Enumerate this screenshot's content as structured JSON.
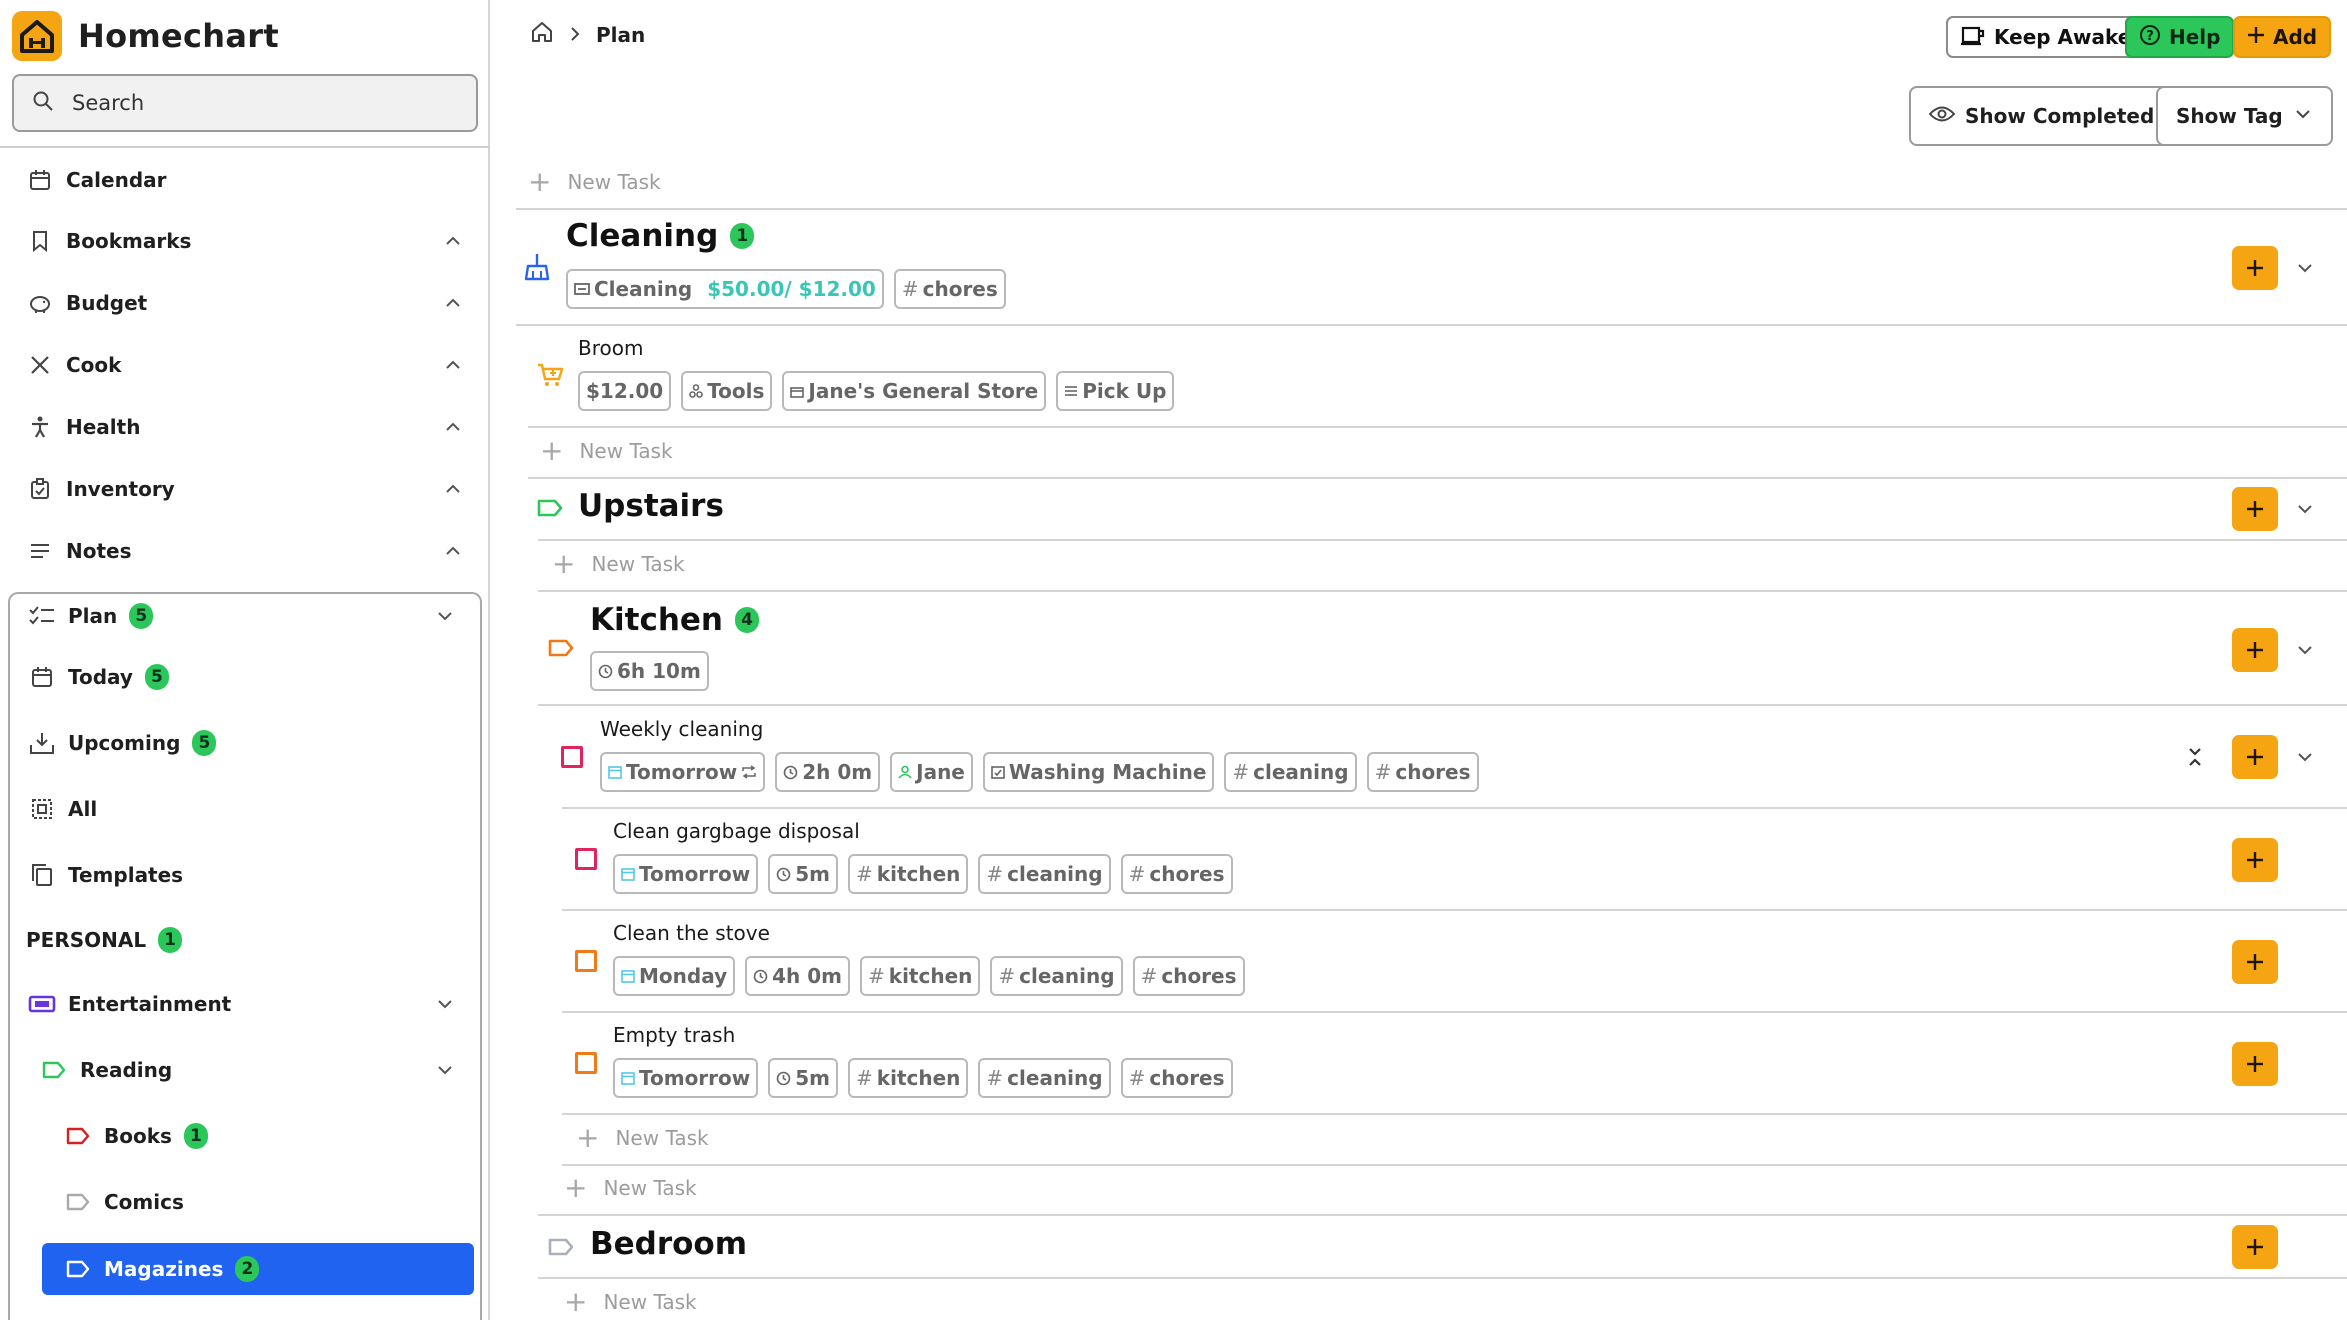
{
  "app": {
    "name": "Homechart"
  },
  "search": {
    "placeholder": "Search"
  },
  "nav": {
    "calendar": "Calendar",
    "bookmarks": "Bookmarks",
    "budget": "Budget",
    "cook": "Cook",
    "health": "Health",
    "inventory": "Inventory",
    "notes": "Notes"
  },
  "plan_nav": {
    "plan": {
      "label": "Plan",
      "count": "5"
    },
    "today": {
      "label": "Today",
      "count": "5"
    },
    "upcoming": {
      "label": "Upcoming",
      "count": "5"
    },
    "all": {
      "label": "All"
    },
    "templates": {
      "label": "Templates"
    },
    "personal": {
      "label": "PERSONAL",
      "count": "1"
    },
    "entertainment": {
      "label": "Entertainment"
    },
    "reading": {
      "label": "Reading"
    },
    "books": {
      "label": "Books",
      "count": "1"
    },
    "comics": {
      "label": "Comics"
    },
    "magazines": {
      "label": "Magazines",
      "count": "2"
    }
  },
  "breadcrumb": {
    "current": "Plan"
  },
  "toolbar": {
    "keep_awake": "Keep Awake",
    "help": "Help",
    "add": "Add",
    "show_completed": "Show Completed",
    "show_tag": "Show Tag"
  },
  "new_task": "New Task",
  "cleaning": {
    "title": "Cleaning",
    "count": "1",
    "budget_label": "Cleaning",
    "budget_values": "$50.00/ $12.00",
    "tag": "chores",
    "item": {
      "title": "Broom",
      "price": "$12.00",
      "category": "Tools",
      "store": "Jane's General Store",
      "status": "Pick Up"
    }
  },
  "upstairs": {
    "title": "Upstairs"
  },
  "kitchen": {
    "title": "Kitchen",
    "count": "4",
    "duration": "6h 10m",
    "weekly": {
      "title": "Weekly cleaning",
      "date": "Tomorrow",
      "duration": "2h 0m",
      "assignee": "Jane",
      "item": "Washing Machine",
      "tags": [
        "cleaning",
        "chores"
      ]
    },
    "subtasks": [
      {
        "title": "Clean gargbage disposal",
        "date": "Tomorrow",
        "duration": "5m",
        "tags": [
          "kitchen",
          "cleaning",
          "chores"
        ]
      },
      {
        "title": "Clean the stove",
        "date": "Monday",
        "duration": "4h 0m",
        "tags": [
          "kitchen",
          "cleaning",
          "chores"
        ]
      },
      {
        "title": "Empty trash",
        "date": "Tomorrow",
        "duration": "5m",
        "tags": [
          "kitchen",
          "cleaning",
          "chores"
        ]
      }
    ]
  },
  "bedroom": {
    "title": "Bedroom"
  },
  "colors": {
    "accent": "#f5a512",
    "green": "#2bc75b",
    "active": "#1f63f0",
    "pink": "#e0245e",
    "orange": "#f07a1a"
  }
}
